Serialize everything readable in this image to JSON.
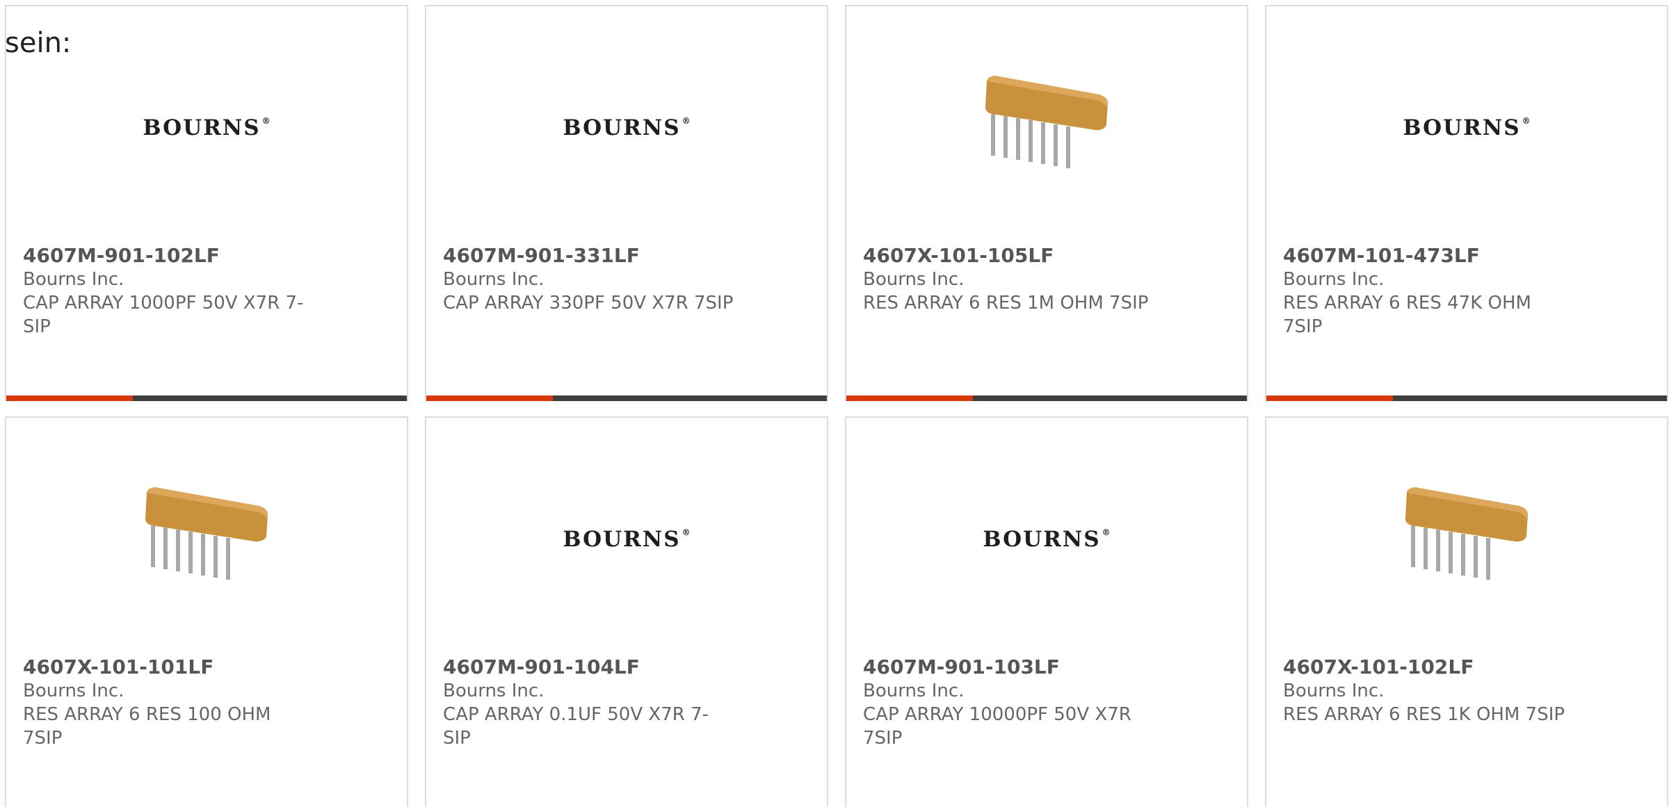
{
  "intro_text": "sein:",
  "colors": {
    "accent": "#d8380c",
    "bar": "#3d3d3d",
    "card_border": "#dcdcdc",
    "resistor_body": "#c9913c",
    "pin": "#a8a8a8"
  },
  "products": [
    {
      "part_number": "4607M-901-102LF",
      "manufacturer": "Bourns Inc.",
      "description": "CAP ARRAY 1000PF 50V X7R 7-SIP",
      "image": "bourns-logo",
      "logo_text": "BOURNS",
      "logo_mark": "®"
    },
    {
      "part_number": "4607M-901-331LF",
      "manufacturer": "Bourns Inc.",
      "description": "CAP ARRAY 330PF 50V X7R 7SIP",
      "image": "bourns-logo",
      "logo_text": "BOURNS",
      "logo_mark": "®"
    },
    {
      "part_number": "4607X-101-105LF",
      "manufacturer": "Bourns Inc.",
      "description": "RES ARRAY 6 RES 1M OHM 7SIP",
      "image": "resistor-array"
    },
    {
      "part_number": "4607M-101-473LF",
      "manufacturer": "Bourns Inc.",
      "description": "RES ARRAY 6 RES 47K OHM 7SIP",
      "image": "bourns-logo",
      "logo_text": "BOURNS",
      "logo_mark": "®"
    },
    {
      "part_number": "4607X-101-101LF",
      "manufacturer": "Bourns Inc.",
      "description": "RES ARRAY 6 RES 100 OHM 7SIP",
      "image": "resistor-array"
    },
    {
      "part_number": "4607M-901-104LF",
      "manufacturer": "Bourns Inc.",
      "description": "CAP ARRAY 0.1UF 50V X7R 7-SIP",
      "image": "bourns-logo",
      "logo_text": "BOURNS",
      "logo_mark": "®"
    },
    {
      "part_number": "4607M-901-103LF",
      "manufacturer": "Bourns Inc.",
      "description": "CAP ARRAY 10000PF 50V X7R 7SIP",
      "image": "bourns-logo",
      "logo_text": "BOURNS",
      "logo_mark": "®"
    },
    {
      "part_number": "4607X-101-102LF",
      "manufacturer": "Bourns Inc.",
      "description": "RES ARRAY 6 RES 1K OHM 7SIP",
      "image": "resistor-array"
    }
  ]
}
